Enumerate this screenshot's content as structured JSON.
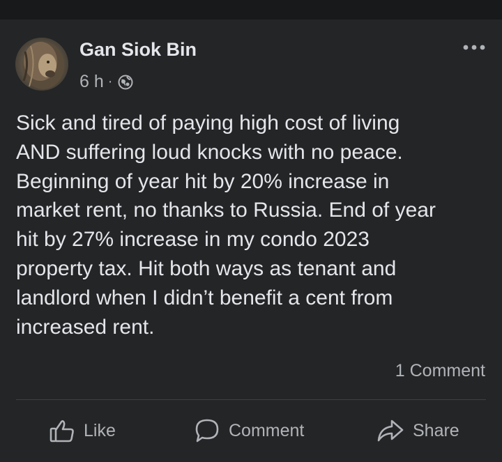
{
  "post": {
    "author": "Gan Siok Bin",
    "time": "6 h",
    "separator": "·",
    "audience_icon": "globe-icon",
    "more_icon": "more-horizontal-icon",
    "text": "Sick and tired of paying high cost of living\nAND suffering loud knocks with no peace.\nBeginning of year hit by 20% increase in\nmarket rent, no thanks to Russia. End of year\nhit by 27% increase in my condo 2023\nproperty tax. Hit both ways as tenant and\nlandlord when I didn’t benefit a cent from\nincreased rent.",
    "comment_count": "1 Comment"
  },
  "actions": {
    "like": {
      "label": "Like",
      "icon": "thumbs-up-icon"
    },
    "comment": {
      "label": "Comment",
      "icon": "comment-icon"
    },
    "share": {
      "label": "Share",
      "icon": "share-icon"
    }
  },
  "colors": {
    "page_background": "#18191a",
    "card_background": "#242526",
    "primary_text": "#e4e6eb",
    "secondary_text": "#b0b3b8",
    "divider": "#3e4042"
  }
}
